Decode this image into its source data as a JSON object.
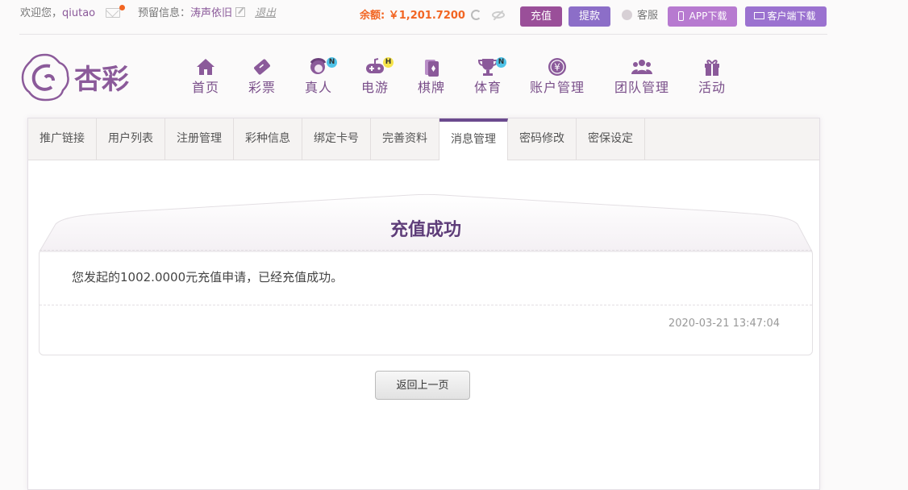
{
  "topbar": {
    "welcome_prefix": "欢迎您，",
    "username": "qiutao",
    "reserved_label": "预留信息：",
    "reserved_value": "涛声依旧",
    "logout": "退出",
    "balance_label": "余额:",
    "balance_value": "￥1,201.7200",
    "recharge": "充值",
    "withdraw": "提款",
    "service": "客服",
    "app_download": "APP下载",
    "client_download": "客户端下载"
  },
  "nav": {
    "items": [
      {
        "label": "首页",
        "icon": "home-icon"
      },
      {
        "label": "彩票",
        "icon": "ticket-icon"
      },
      {
        "label": "真人",
        "icon": "live-dealer-icon",
        "badge": "N"
      },
      {
        "label": "电游",
        "icon": "gamepad-icon",
        "badge": "H"
      },
      {
        "label": "棋牌",
        "icon": "cards-icon"
      },
      {
        "label": "体育",
        "icon": "trophy-icon",
        "badge": "N"
      },
      {
        "label": "账户管理",
        "icon": "yen-coin-icon"
      },
      {
        "label": "团队管理",
        "icon": "team-icon"
      },
      {
        "label": "活动",
        "icon": "gift-icon"
      }
    ]
  },
  "tabs": [
    "推广链接",
    "用户列表",
    "注册管理",
    "彩种信息",
    "绑定卡号",
    "完善资料",
    "消息管理",
    "密码修改",
    "密保设定"
  ],
  "active_tab_index": 6,
  "message": {
    "title": "充值成功",
    "body": "您发起的1002.0000元充值申请，已经充值成功。",
    "time": "2020-03-21 13:47:04"
  },
  "back_button": "返回上一页",
  "colors": {
    "brand_purple": "#6b4a8e",
    "recharge_bg": "#9a4f99",
    "withdraw_bg": "#8c6ec8",
    "balance": "#f26522",
    "badge_N": "#4fc3e8",
    "badge_H": "#f6e44a"
  }
}
